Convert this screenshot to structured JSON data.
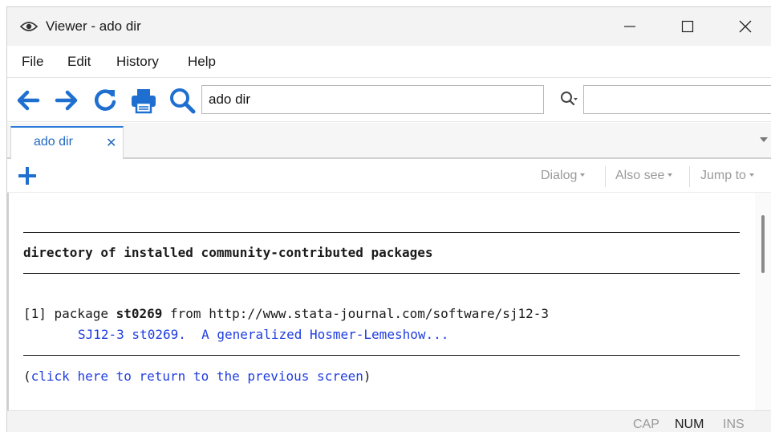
{
  "window": {
    "title": "Viewer - ado dir"
  },
  "menu": [
    "File",
    "Edit",
    "History",
    "Help"
  ],
  "toolbar": {
    "address_value": "ado dir",
    "search_value": ""
  },
  "tabs": [
    {
      "label": "ado dir",
      "close": "✕"
    }
  ],
  "subbar": {
    "dialog": "Dialog",
    "also_see": "Also see",
    "jump_to": "Jump to"
  },
  "content": {
    "heading": "directory of installed community-contributed packages",
    "package_index": "[1] package ",
    "package_name": "st0269",
    "package_from": " from http://www.stata-journal.com/software/sj12-3",
    "package_desc": "SJ12-3 st0269.  A generalized Hosmer-Lemeshow...",
    "return_open": "(",
    "return_link": "click here to return to the previous screen",
    "return_close": ")"
  },
  "status": {
    "cap": "CAP",
    "num": "NUM",
    "ins": "INS"
  },
  "colors": {
    "accent": "#2269c2",
    "link": "#1f3de0",
    "icon_blue": "#1f6fd1",
    "disabled_text": "#9a9a9a"
  },
  "icons": [
    "eye-icon",
    "minimize-icon",
    "maximize-icon",
    "close-icon",
    "back-arrow-icon",
    "forward-arrow-icon",
    "refresh-icon",
    "print-icon",
    "search-icon",
    "find-icon",
    "plus-icon",
    "chevron-down-icon"
  ]
}
